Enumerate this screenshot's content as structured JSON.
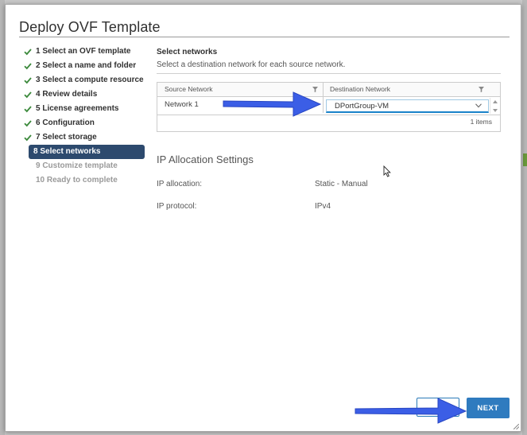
{
  "dialog": {
    "title": "Deploy OVF Template"
  },
  "steps": [
    {
      "label": "1 Select an OVF template",
      "state": "done"
    },
    {
      "label": "2 Select a name and folder",
      "state": "done"
    },
    {
      "label": "3 Select a compute resource",
      "state": "done"
    },
    {
      "label": "4 Review details",
      "state": "done"
    },
    {
      "label": "5 License agreements",
      "state": "done"
    },
    {
      "label": "6 Configuration",
      "state": "done"
    },
    {
      "label": "7 Select storage",
      "state": "done"
    },
    {
      "label": "8 Select networks",
      "state": "current"
    },
    {
      "label": "9 Customize template",
      "state": "future"
    },
    {
      "label": "10 Ready to complete",
      "state": "future"
    }
  ],
  "networks": {
    "title": "Select networks",
    "description": "Select a destination network for each source network.",
    "columns": {
      "source": "Source Network",
      "destination": "Destination Network"
    },
    "rows": [
      {
        "source": "Network 1",
        "destination": "DPortGroup-VM"
      }
    ],
    "footer": "1 items"
  },
  "ip": {
    "title": "IP Allocation Settings",
    "allocation_label": "IP allocation:",
    "allocation_value": "Static - Manual",
    "protocol_label": "IP protocol:",
    "protocol_value": "IPv4"
  },
  "buttons": {
    "cancel": "",
    "next": "NEXT"
  },
  "colors": {
    "accent": "#2f7bbf",
    "current_step": "#2d4a6e",
    "check": "#3c8a3c",
    "annotation_arrow": "#3b5ee6"
  },
  "icons": {
    "step_done": "check-icon",
    "column_filter": "filter-icon",
    "dropdown": "chevron-down-icon",
    "pointer": "cursor-icon",
    "annotation": "arrow-icon"
  }
}
